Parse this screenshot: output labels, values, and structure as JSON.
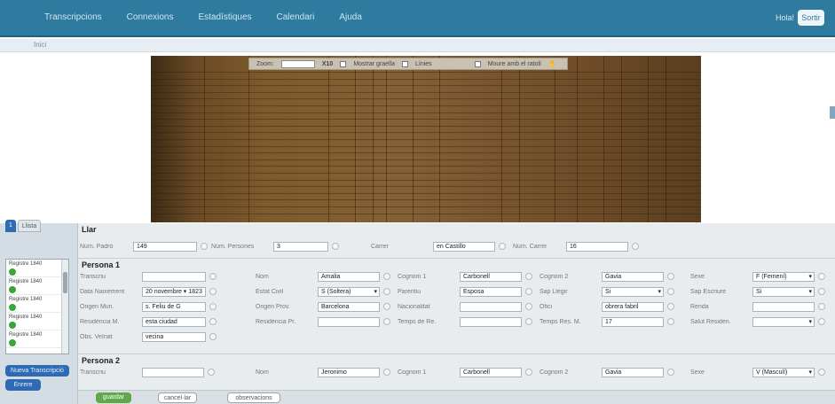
{
  "topbar": {
    "menu": [
      "Transcripcions",
      "Connexions",
      "Estadístiques",
      "Calendari",
      "Ajuda"
    ],
    "user": "Hola!",
    "exit_label": "Sortir"
  },
  "subbar": {
    "crumb": "Inici"
  },
  "viewer": {
    "tools": {
      "zoom_label": "Zoom:",
      "zoom_value": "",
      "zoom_step": "X10",
      "grid_label": "Mostrar graella",
      "lines_label": "Línies",
      "move_label": "Moure amb el ratolí"
    }
  },
  "tabs": {
    "tab1": "1",
    "tab2": "Llista"
  },
  "registers": {
    "items": [
      "Registre 1840",
      "Registre 1840",
      "Registre 1840",
      "Registre 1840",
      "Registre 1840"
    ]
  },
  "side": {
    "new_button": "Nueva Transcripció",
    "back_button": "Enrere"
  },
  "llar": {
    "title": "Llar",
    "fields": [
      {
        "label": "Núm. Padró",
        "value": "149"
      },
      {
        "label": "Núm. Persones",
        "value": "3"
      },
      {
        "label": "Carrer",
        "value": "en Castillo"
      },
      {
        "label": "Núm. Carrer",
        "value": "16"
      }
    ]
  },
  "persona1": {
    "title": "Persona 1",
    "rows": [
      [
        {
          "label": "Transcriu",
          "value": ""
        },
        {
          "label": "Nom",
          "value": "Amalia"
        },
        {
          "label": "Cognom 1",
          "value": "Carbonell"
        },
        {
          "label": "Cognom 2",
          "value": "Gavia"
        },
        {
          "label": "Sexe",
          "value": "F (Femení)",
          "select": true
        }
      ],
      [
        {
          "label": "Data Naixement",
          "value": "20   novembre  ▾  1823"
        },
        {
          "label": "Estat Civil",
          "value": "S (Soltera)",
          "select": true
        },
        {
          "label": "Parentiu",
          "value": "Esposa"
        },
        {
          "label": "Sap Llegir",
          "value": "Si",
          "select": true
        },
        {
          "label": "Sap Escriure",
          "value": "Si",
          "select": true
        }
      ],
      [
        {
          "label": "Origen Mun.",
          "value": "s. Feliu de G"
        },
        {
          "label": "Origen Prov.",
          "value": "Barcelona"
        },
        {
          "label": "Nacionalitat",
          "value": ""
        },
        {
          "label": "Ofici",
          "value": "obrera fabril"
        },
        {
          "label": "Renda",
          "value": ""
        }
      ],
      [
        {
          "label": "Residència M.",
          "value": "esta ciudad"
        },
        {
          "label": "Residència Pr.",
          "value": ""
        },
        {
          "label": "Temps de Re.",
          "value": ""
        },
        {
          "label": "Temps Res. M.",
          "value": "17"
        },
        {
          "label": "Salut Residen.",
          "value": "",
          "select": true
        }
      ],
      [
        {
          "label": "Obs. Veïnat",
          "value": "vecina"
        },
        {
          "label": "",
          "value": ""
        },
        {
          "label": "",
          "value": ""
        },
        {
          "label": "",
          "value": ""
        },
        {
          "label": "",
          "value": ""
        }
      ]
    ]
  },
  "persona2": {
    "title": "Persona 2",
    "rows": [
      [
        {
          "label": "Transcriu",
          "value": ""
        },
        {
          "label": "Nom",
          "value": "Jeronimo"
        },
        {
          "label": "Cognom 1",
          "value": "Carbonell"
        },
        {
          "label": "Cognom 2",
          "value": "Gavia"
        },
        {
          "label": "Sexe",
          "value": "V (Masculí)",
          "select": true
        }
      ]
    ]
  },
  "bottom": {
    "save": "guardar",
    "cancel": "cancel·lar",
    "obs": "observacions"
  }
}
